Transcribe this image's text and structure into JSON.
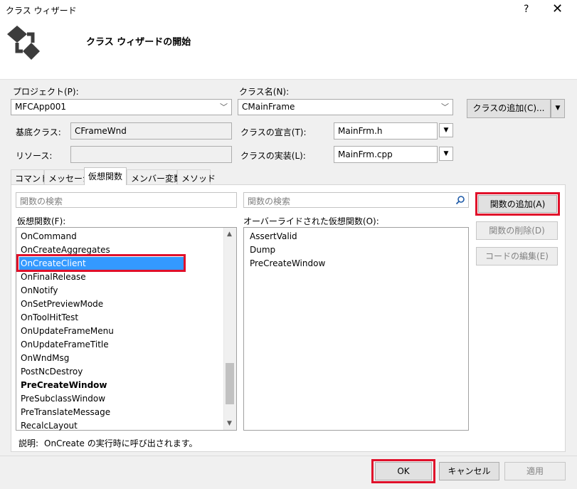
{
  "window": {
    "title": "クラス ウィザード",
    "help": "?",
    "close": "✕"
  },
  "header": {
    "title": "クラス ウィザードの開始"
  },
  "form": {
    "project_label": "プロジェクト(P):",
    "project_value": "MFCApp001",
    "classname_label": "クラス名(N):",
    "classname_value": "CMainFrame",
    "add_class_button": "クラスの追加(C)...",
    "add_class_dropdown": "▼",
    "base_class_label": "基底クラス:",
    "base_class_value": "CFrameWnd",
    "class_decl_label": "クラスの宣言(T):",
    "class_decl_value": "MainFrm.h",
    "resource_label": "リソース:",
    "resource_value": "",
    "class_impl_label": "クラスの実装(L):",
    "class_impl_value": "MainFrm.cpp",
    "browse_glyph": "▼"
  },
  "tabs": [
    {
      "label": "コマンド"
    },
    {
      "label": "メッセージ"
    },
    {
      "label": "仮想関数"
    },
    {
      "label": "メンバー変数"
    },
    {
      "label": "メソッド"
    }
  ],
  "virtual_functions": {
    "search_left_placeholder": "関数の検索",
    "search_right_placeholder": "関数の検索",
    "list_label": "仮想関数(F):",
    "overridden_label": "オーバーライドされた仮想関数(O):",
    "items": [
      "OnCommand",
      "OnCreateAggregates",
      "OnCreateClient",
      "OnFinalRelease",
      "OnNotify",
      "OnSetPreviewMode",
      "OnToolHitTest",
      "OnUpdateFrameMenu",
      "OnUpdateFrameTitle",
      "OnWndMsg",
      "PostNcDestroy",
      "PreCreateWindow",
      "PreSubclassWindow",
      "PreTranslateMessage",
      "RecalcLayout"
    ],
    "selected_item": "OnCreateClient",
    "bold_item": "PreCreateWindow",
    "overridden_items": [
      "AssertValid",
      "Dump",
      "PreCreateWindow"
    ],
    "add_function_button": "関数の追加(A)",
    "delete_function_button": "関数の削除(D)",
    "edit_code_button": "コードの編集(E)",
    "description_label": "説明:",
    "description_text": "OnCreate の実行時に呼び出されます。"
  },
  "footer": {
    "ok_button": "OK",
    "cancel_button": "キャンセル",
    "apply_button": "適用"
  },
  "colors": {
    "highlight_red": "#e0102a",
    "selection_blue": "#3399ff"
  }
}
